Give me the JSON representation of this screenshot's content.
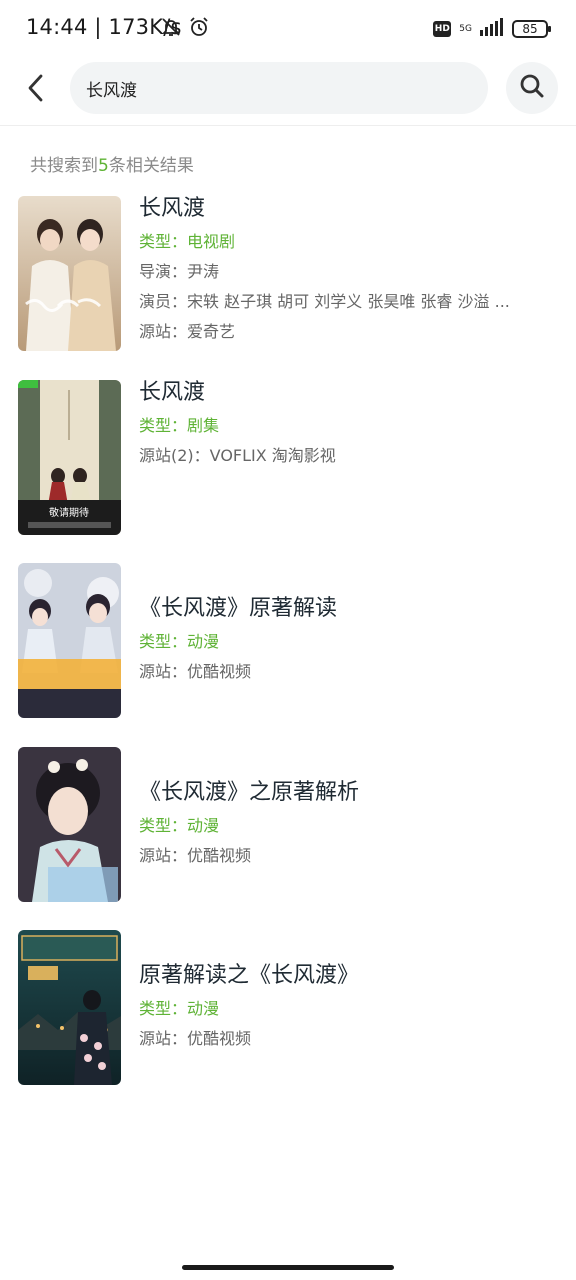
{
  "status_bar": {
    "time_speed": "14:44 | 173K/s",
    "network": "5G",
    "battery": "85"
  },
  "search": {
    "query": "长风渡"
  },
  "results_summary": {
    "prefix": "共搜索到",
    "count": "5",
    "suffix": "条相关结果"
  },
  "results": [
    {
      "title": "长风渡",
      "type": "类型：电视剧",
      "director": "导演：尹涛",
      "cast": "演员：宋轶 赵子琪 胡可 刘学义 张昊唯 张睿 沙溢 ...",
      "source": "源站：爱奇艺"
    },
    {
      "title": "长风渡",
      "type": "类型：剧集",
      "source": "源站(2)：VOFLIX 淘淘影视",
      "poster_caption": "敬请期待"
    },
    {
      "title": "《长风渡》原著解读",
      "type": "类型：动漫",
      "source": "源站：优酷视频"
    },
    {
      "title": "《长风渡》之原著解析",
      "type": "类型：动漫",
      "source": "源站：优酷视频"
    },
    {
      "title": "原著解读之《长风渡》",
      "type": "类型：动漫",
      "source": "源站：优酷视频"
    }
  ],
  "colors": {
    "accent_green": "#5fb336",
    "title_dark": "#1f2a33",
    "meta_gray": "#666666"
  }
}
